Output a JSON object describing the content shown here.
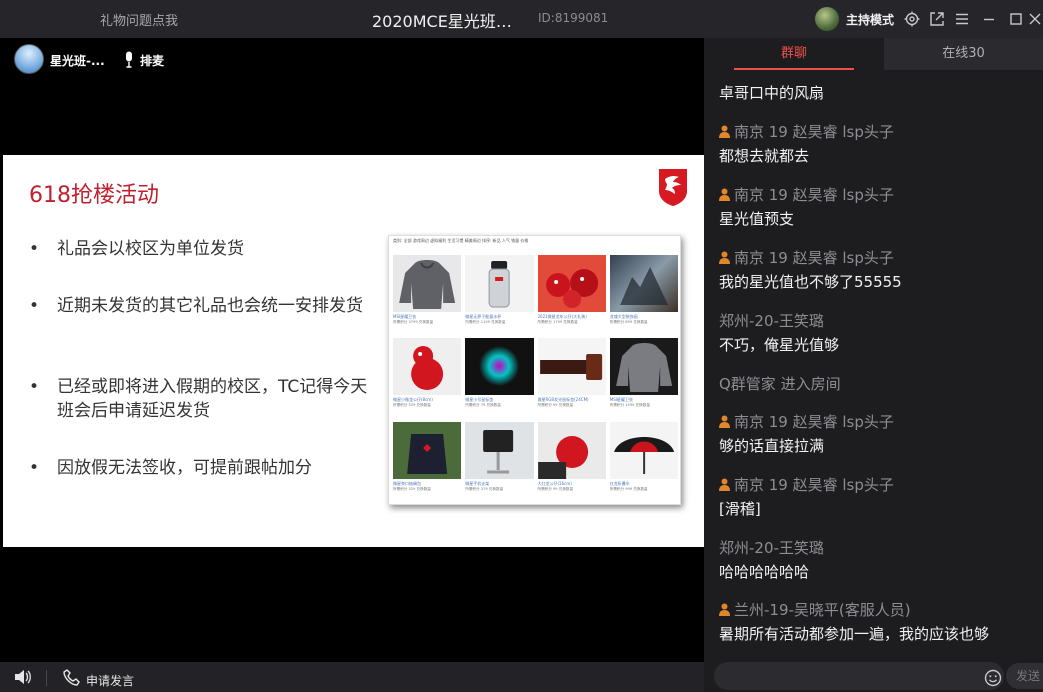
{
  "titlebar": {
    "left_link": "礼物问题点我",
    "title": "2020MCE星光班全...",
    "room_id": "ID:8199081",
    "host_mode": "主持模式",
    "icons": [
      "settings-icon",
      "popout-icon",
      "menu-icon",
      "minimize-icon",
      "maximize-icon",
      "close-icon"
    ]
  },
  "video": {
    "class_name": "星光班-...",
    "mic_queue_label": "排麦"
  },
  "slide": {
    "title": "618抢楼活动",
    "bullets": [
      "礼品会以校区为单位发货",
      "近期未发货的其它礼品也会统一安排发货",
      "已经或即将进入假期的校区，TC记得今天班会后申请延迟发货",
      "因放假无法签收，可提前跟帖加分"
    ],
    "products_filter": "类别: 全部 游戏周边 虚拟福利 生活习惯 精美周边  排序: 新品 人气 销量 价格",
    "products": [
      {
        "name": "MSI星耀卫衣",
        "meta": "所需积分 3799 兑换数量"
      },
      {
        "name": "微星无界子能量水杯",
        "meta": "所需积分 1199 兑换数量"
      },
      {
        "name": "2021微星龙年公仔(大礼装)",
        "meta": "所需积分 1799 兑换数量"
      },
      {
        "name": "龙魂大型装饰画",
        "meta": "所需积分 899 兑换数量"
      },
      {
        "name": "微星小微龙公仔(8cm)",
        "meta": "所需积分 529 兑换数量"
      },
      {
        "name": "微星小号鼠标垫",
        "meta": "所需积分 79 兑换数量"
      },
      {
        "name": "微星RGB发光鼠标垫(24CM)",
        "meta": "所需积分 99 兑换数量"
      },
      {
        "name": "MSI星耀卫衣",
        "meta": "所需积分 1599 兑换数量"
      },
      {
        "name": "微星束口抽绳包",
        "meta": "所需积分 329 兑换数量"
      },
      {
        "name": "微星手机支架",
        "meta": "所需积分 379 兑换数量"
      },
      {
        "name": "大红龙公仔(16cm)",
        "meta": "所需积分 99 兑换数量"
      },
      {
        "name": "红龙折叠伞",
        "meta": "所需积分 999 兑换数量"
      }
    ]
  },
  "bottombar": {
    "apply_speak": "申请发言"
  },
  "chat": {
    "tabs": {
      "group": "群聊",
      "online": "在线30"
    },
    "partial_top_text": "卓哥口中的风扇",
    "messages": [
      {
        "sender": "南京 19 赵昊睿 lsp头子",
        "badge": true,
        "text": "都想去就都去"
      },
      {
        "sender": "南京 19 赵昊睿 lsp头子",
        "badge": true,
        "text": "星光值预支"
      },
      {
        "sender": "南京 19 赵昊睿 lsp头子",
        "badge": true,
        "text": "我的星光值也不够了55555"
      },
      {
        "sender": "郑州-20-王笑璐",
        "badge": false,
        "text": "不巧，俺星光值够"
      },
      {
        "sender": "",
        "badge": false,
        "text": "",
        "system": "Q群管家 进入房间"
      },
      {
        "sender": "南京 19 赵昊睿 lsp头子",
        "badge": true,
        "text": "够的话直接拉满"
      },
      {
        "sender": "南京 19 赵昊睿 lsp头子",
        "badge": true,
        "text": "[滑稽]"
      },
      {
        "sender": "郑州-20-王笑璐",
        "badge": false,
        "text": "哈哈哈哈哈哈"
      },
      {
        "sender": "兰州-19-吴晓平(客服人员)",
        "badge": true,
        "text": "暑期所有活动都参加一遍，我的应该也够"
      }
    ],
    "send_label": "发送"
  }
}
